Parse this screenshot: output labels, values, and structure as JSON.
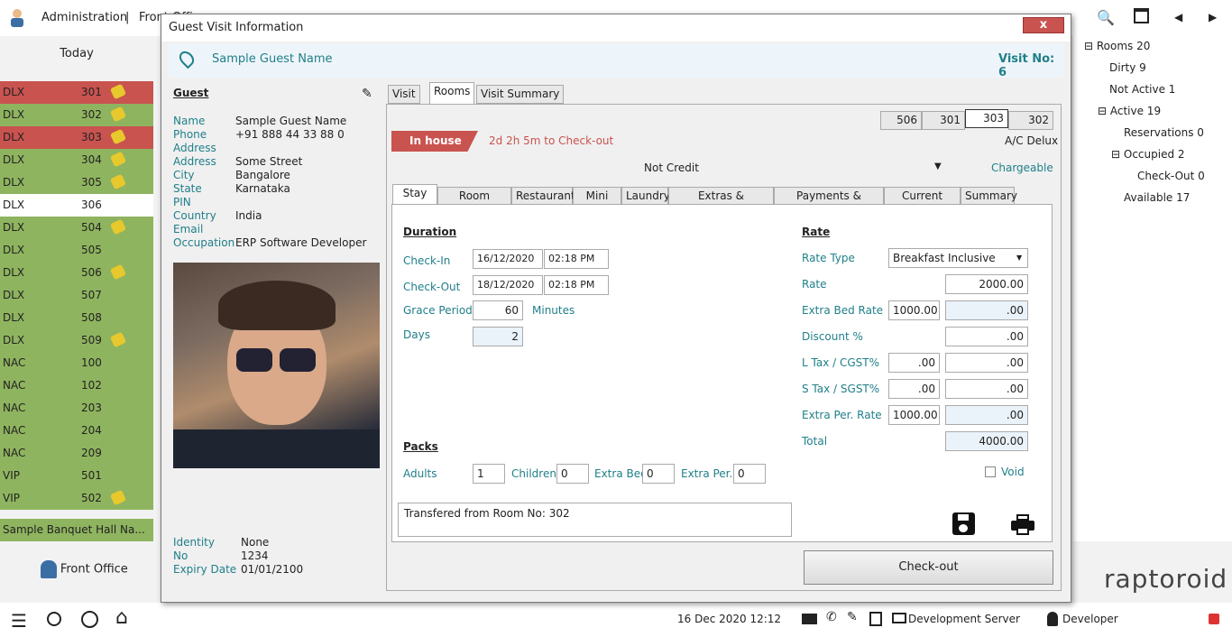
{
  "header": {
    "admin": "Administration",
    "sep": "|",
    "front": "Front Office"
  },
  "left": {
    "today": "Today",
    "rooms": [
      {
        "type": "DLX",
        "no": "301",
        "status": "r",
        "broom": true
      },
      {
        "type": "DLX",
        "no": "302",
        "status": "g",
        "broom": true
      },
      {
        "type": "DLX",
        "no": "303",
        "status": "r",
        "broom": true
      },
      {
        "type": "DLX",
        "no": "304",
        "status": "g",
        "broom": true
      },
      {
        "type": "DLX",
        "no": "305",
        "status": "g",
        "broom": true
      },
      {
        "type": "DLX",
        "no": "306",
        "status": "w",
        "broom": false
      },
      {
        "type": "DLX",
        "no": "504",
        "status": "g",
        "broom": true
      },
      {
        "type": "DLX",
        "no": "505",
        "status": "g",
        "broom": false
      },
      {
        "type": "DLX",
        "no": "506",
        "status": "g",
        "broom": true
      },
      {
        "type": "DLX",
        "no": "507",
        "status": "g",
        "broom": false
      },
      {
        "type": "DLX",
        "no": "508",
        "status": "g",
        "broom": false
      },
      {
        "type": "DLX",
        "no": "509",
        "status": "g",
        "broom": true
      },
      {
        "type": "NAC",
        "no": "100",
        "status": "g",
        "broom": false
      },
      {
        "type": "NAC",
        "no": "102",
        "status": "g",
        "broom": false
      },
      {
        "type": "NAC",
        "no": "203",
        "status": "g",
        "broom": false
      },
      {
        "type": "NAC",
        "no": "204",
        "status": "g",
        "broom": false
      },
      {
        "type": "NAC",
        "no": "209",
        "status": "g",
        "broom": false
      },
      {
        "type": "VIP",
        "no": "501",
        "status": "g",
        "broom": false
      },
      {
        "type": "VIP",
        "no": "502",
        "status": "g",
        "broom": true
      }
    ],
    "banquet": "Sample Banquet Hall Na...",
    "frontoffice": "Front Office"
  },
  "tree": {
    "rooms": "Rooms 20",
    "dirty": "Dirty 9",
    "notactive": "Not Active 1",
    "active": "Active 19",
    "reservations": "Reservations 0",
    "occupied": "Occupied 2",
    "checkout": "Check-Out 0",
    "available": "Available 17"
  },
  "brand": "raptoroid",
  "status": {
    "datetime": "16 Dec 2020 12:12",
    "server": "Development Server",
    "user": "Developer"
  },
  "modal": {
    "title": "Guest Visit Information",
    "close": "x",
    "guestname": "Sample Guest Name",
    "visitno": "Visit No: 6",
    "guest": {
      "heading": "Guest",
      "name_l": "Name",
      "name": "Sample Guest Name",
      "phone_l": "Phone",
      "phone": "+91 888 44 33 88 0",
      "addr_l": "Address",
      "addr1_l": "Address",
      "addr1": "Some Street",
      "city_l": "City",
      "city": "Bangalore",
      "state_l": "State",
      "state": "Karnataka",
      "pin_l": "PIN",
      "country_l": "Country",
      "country": "India",
      "email_l": "Email",
      "occ_l": "Occupation",
      "occ": "ERP Software Developer",
      "id_l": "Identity",
      "id": "None",
      "no_l": "No",
      "no": "1234",
      "exp_l": "Expiry Date",
      "exp": "01/01/2100"
    },
    "tabs": [
      "Visit",
      "Rooms",
      "Visit Summary"
    ],
    "roomtabs": [
      "506",
      "301",
      "303",
      "302"
    ],
    "inhouse": "In house",
    "checkoutin": "2d 2h 5m to Check-out",
    "roomtype": "A/C Delux",
    "credit": "Not Credit",
    "chargeable": "Chargeable",
    "subtabs": [
      "Stay",
      "Room Service",
      "Restaurant",
      "Mini Bar",
      "Laundry",
      "Extras & Deductions",
      "Payments & Receipts",
      "Current Status",
      "Summary"
    ],
    "duration": {
      "heading": "Duration",
      "checkin_l": "Check-In",
      "checkin_d": "16/12/2020",
      "checkin_t": "02:18 PM",
      "checkout_l": "Check-Out",
      "checkout_d": "18/12/2020",
      "checkout_t": "02:18 PM",
      "grace_l": "Grace Period",
      "grace": "60",
      "minutes": "Minutes",
      "days_l": "Days",
      "days": "2"
    },
    "packs": {
      "heading": "Packs",
      "adults_l": "Adults",
      "adults": "1",
      "children_l": "Children",
      "children": "0",
      "extrabed_l": "Extra Bed",
      "extrabed": "0",
      "extraper_l": "Extra Per.",
      "extraper": "0"
    },
    "note": "Transfered from Room No: 302",
    "rate": {
      "heading": "Rate",
      "type_l": "Rate Type",
      "type": "Breakfast Inclusive",
      "rate_l": "Rate",
      "rate": "2000.00",
      "ebr_l": "Extra Bed Rate",
      "ebr": "1000.00",
      "ebr2": ".00",
      "disc_l": "Discount %",
      "disc": ".00",
      "ltax_l": "L Tax / CGST%",
      "ltax": ".00",
      "ltax2": ".00",
      "stax_l": "S Tax / SGST%",
      "stax": ".00",
      "stax2": ".00",
      "epr_l": "Extra Per. Rate",
      "epr": "1000.00",
      "epr2": ".00",
      "total_l": "Total",
      "total": "4000.00",
      "void": "Void"
    },
    "checkoutbtn": "Check-out"
  }
}
